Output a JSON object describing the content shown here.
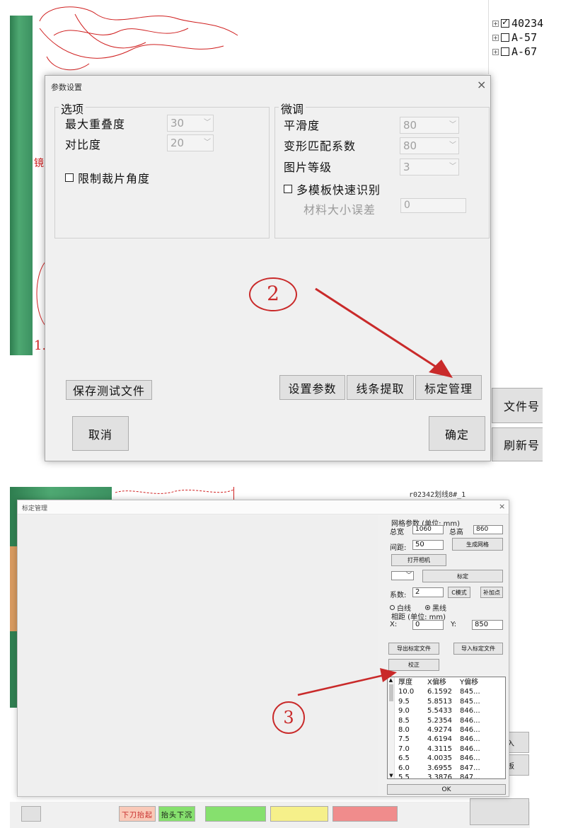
{
  "top": {
    "tree_items": [
      {
        "label": "40234",
        "checked": true
      },
      {
        "label": "A-57",
        "checked": false
      },
      {
        "label": "A-67",
        "checked": false
      }
    ],
    "background_text_1": "镜",
    "background_text_2": "1.",
    "right_buttons": [
      "文件号",
      "刷新号"
    ],
    "dialog": {
      "title": "参数设置",
      "close": "×",
      "options_group": {
        "legend": "选项",
        "max_overlap_label": "最大重叠度",
        "max_overlap_value": "30",
        "contrast_label": "对比度",
        "contrast_value": "20",
        "limit_angle_label": "限制裁片角度"
      },
      "tune_group": {
        "legend": "微调",
        "smooth_label": "平滑度",
        "smooth_value": "80",
        "deform_label": "变形匹配系数",
        "deform_value": "80",
        "image_level_label": "图片等级",
        "image_level_value": "3",
        "multi_template_label": "多模板快速识别",
        "material_size_label": "材料大小误差",
        "material_size_value": "0"
      },
      "save_test_file": "保存测试文件",
      "set_params": "设置参数",
      "line_extract": "线条提取",
      "calibration_mgmt": "标定管理",
      "cancel": "取消",
      "ok": "确定"
    },
    "annotation": "2"
  },
  "bottom": {
    "tree_label": "r02342划线8#_1",
    "dialog": {
      "title": "标定管理",
      "close": "×",
      "grid_params_label": "网格参数 (单位: mm)",
      "total_width_label": "总宽",
      "total_width_value": "1060",
      "total_height_label": "总高",
      "total_height_value": "860",
      "spacing_label": "间距:",
      "spacing_value": "50",
      "btn_gen_grid": "生成网格",
      "btn_open_camera": "打开相机",
      "btn_calibrate": "标定",
      "coef_label": "系数:",
      "coef_value": "2",
      "btn_mode": "C模式",
      "btn_add_point": "补加点",
      "radio_white": "白线",
      "radio_black": "黑线",
      "offset_label": "相距 (单位: mm)",
      "x_label": "X:",
      "x_value": "0",
      "y_label": "Y:",
      "y_value": "850",
      "btn_export": "导出标定文件",
      "btn_import": "导入标定文件",
      "btn_correct": "校正",
      "table_headers": [
        "厚度",
        "X偏移",
        "Y偏移"
      ],
      "table_rows": [
        [
          "10.0",
          "6.1592",
          "845..."
        ],
        [
          "9.5",
          "5.8513",
          "845..."
        ],
        [
          "9.0",
          "5.5433",
          "846..."
        ],
        [
          "8.5",
          "5.2354",
          "846..."
        ],
        [
          "8.0",
          "4.9274",
          "846..."
        ],
        [
          "7.5",
          "4.6194",
          "846..."
        ],
        [
          "7.0",
          "4.3115",
          "846..."
        ],
        [
          "6.5",
          "4.0035",
          "846..."
        ],
        [
          "6.0",
          "3.6955",
          "847..."
        ],
        [
          "5.5",
          "3.3876",
          "847..."
        ]
      ],
      "btn_ok": "OK"
    },
    "right_buttons": [
      "入",
      "板"
    ],
    "status_buttons": [
      "下刀抬起",
      "抬头下沉"
    ],
    "annotation": "3"
  },
  "colors": {
    "annotation_red": "#c92a2a",
    "green_strip": "#3c9161",
    "green_bar": "#86e06e",
    "yellow_bar": "#f6f08a",
    "pink_bar": "#f08c8c"
  }
}
